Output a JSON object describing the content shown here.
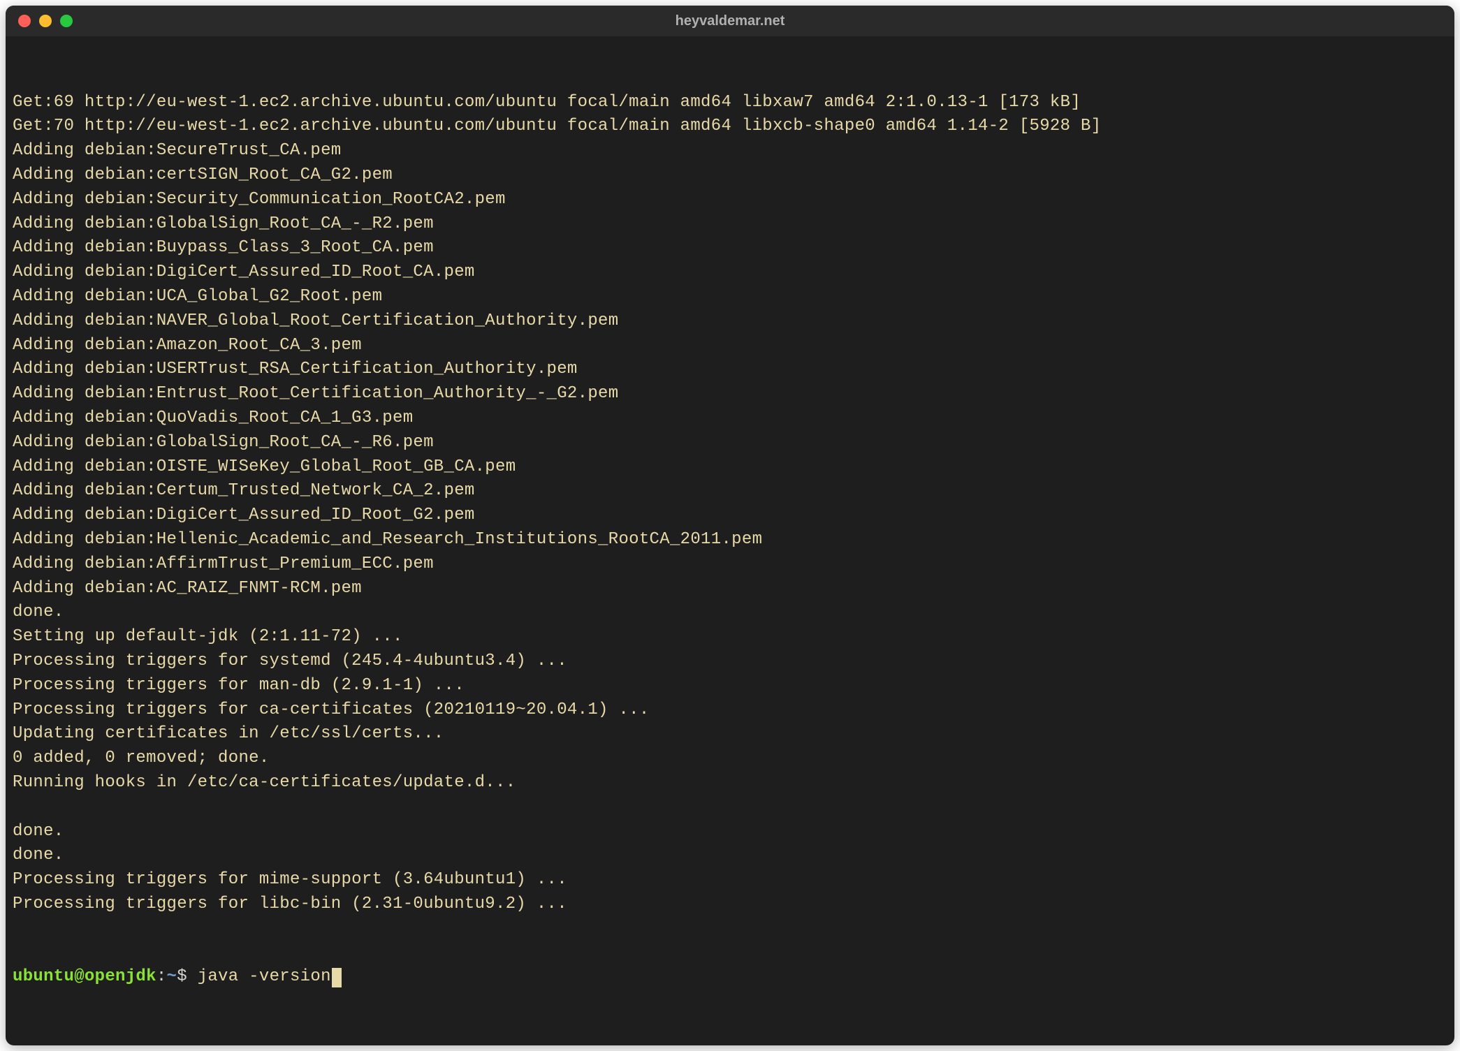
{
  "window": {
    "title": "heyvaldemar.net"
  },
  "terminal": {
    "lines": [
      "Get:69 http://eu-west-1.ec2.archive.ubuntu.com/ubuntu focal/main amd64 libxaw7 amd64 2:1.0.13-1 [173 kB]",
      "Get:70 http://eu-west-1.ec2.archive.ubuntu.com/ubuntu focal/main amd64 libxcb-shape0 amd64 1.14-2 [5928 B]",
      "Adding debian:SecureTrust_CA.pem",
      "Adding debian:certSIGN_Root_CA_G2.pem",
      "Adding debian:Security_Communication_RootCA2.pem",
      "Adding debian:GlobalSign_Root_CA_-_R2.pem",
      "Adding debian:Buypass_Class_3_Root_CA.pem",
      "Adding debian:DigiCert_Assured_ID_Root_CA.pem",
      "Adding debian:UCA_Global_G2_Root.pem",
      "Adding debian:NAVER_Global_Root_Certification_Authority.pem",
      "Adding debian:Amazon_Root_CA_3.pem",
      "Adding debian:USERTrust_RSA_Certification_Authority.pem",
      "Adding debian:Entrust_Root_Certification_Authority_-_G2.pem",
      "Adding debian:QuoVadis_Root_CA_1_G3.pem",
      "Adding debian:GlobalSign_Root_CA_-_R6.pem",
      "Adding debian:OISTE_WISeKey_Global_Root_GB_CA.pem",
      "Adding debian:Certum_Trusted_Network_CA_2.pem",
      "Adding debian:DigiCert_Assured_ID_Root_G2.pem",
      "Adding debian:Hellenic_Academic_and_Research_Institutions_RootCA_2011.pem",
      "Adding debian:AffirmTrust_Premium_ECC.pem",
      "Adding debian:AC_RAIZ_FNMT-RCM.pem",
      "done.",
      "Setting up default-jdk (2:1.11-72) ...",
      "Processing triggers for systemd (245.4-4ubuntu3.4) ...",
      "Processing triggers for man-db (2.9.1-1) ...",
      "Processing triggers for ca-certificates (20210119~20.04.1) ...",
      "Updating certificates in /etc/ssl/certs...",
      "0 added, 0 removed; done.",
      "Running hooks in /etc/ca-certificates/update.d...",
      "",
      "done.",
      "done.",
      "Processing triggers for mime-support (3.64ubuntu1) ...",
      "Processing triggers for libc-bin (2.31-0ubuntu9.2) ..."
    ],
    "prompt": {
      "user_host": "ubuntu@openjdk",
      "colon": ":",
      "path": "~",
      "dollar": "$ ",
      "command": "java -version"
    }
  }
}
